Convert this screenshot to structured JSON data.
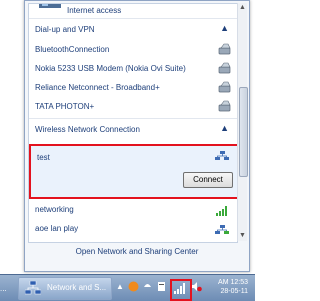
{
  "top": {
    "internet_label": "Internet access"
  },
  "sections": {
    "dialup_header": "Dial-up and VPN",
    "dialup_items": [
      "BluetoothConnection",
      "Nokia 5233 USB Modem (Nokia Ovi Suite)",
      "Reliance Netconnect - Broadband+",
      "TATA PHOTON+"
    ],
    "wireless_header": "Wireless Network Connection",
    "selected_network": {
      "name": "test",
      "connect_label": "Connect"
    },
    "wireless_items": [
      "networking",
      "aoe lan play"
    ]
  },
  "footer": {
    "link": "Open Network and Sharing Center"
  },
  "taskbar": {
    "left_text": "...",
    "window_label": "Network and S...",
    "clock_time": "AM 12:53",
    "clock_date": "28-05-11"
  },
  "colors": {
    "highlight_box": "#e3121e",
    "link_text": "#1e3f7a"
  }
}
